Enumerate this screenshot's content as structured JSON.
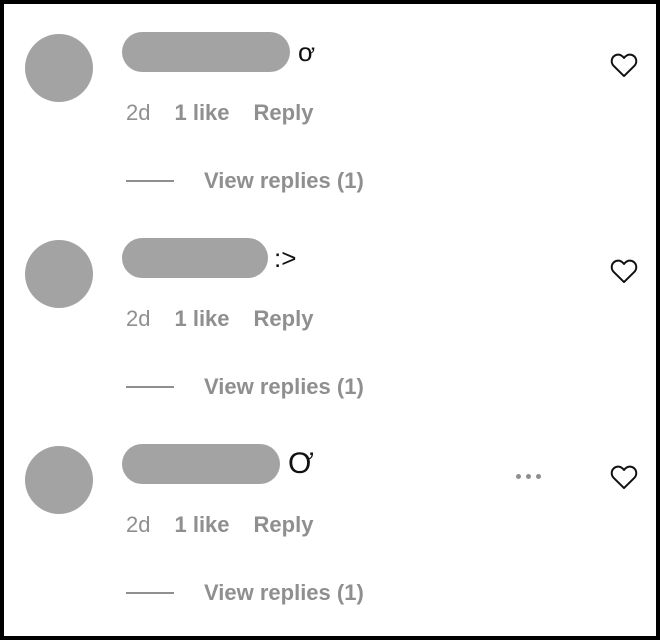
{
  "comments": [
    {
      "text": "ơ",
      "time": "2d",
      "likes": "1 like",
      "reply_label": "Reply",
      "view_replies_label": "View replies (1)",
      "more_options_visible": false
    },
    {
      "text": ":>",
      "time": "2d",
      "likes": "1 like",
      "reply_label": "Reply",
      "view_replies_label": "View replies (1)",
      "more_options_visible": false
    },
    {
      "text": "Ơ",
      "time": "2d",
      "likes": "1 like",
      "reply_label": "Reply",
      "view_replies_label": "View replies (1)",
      "more_options_visible": true
    }
  ],
  "icons": {
    "like": "heart-outline-icon",
    "more": "more-options-icon"
  },
  "colors": {
    "placeholder_gray": "#a3a3a3",
    "secondary_text": "#8f8f8f",
    "primary_text": "#111111",
    "border": "#000000"
  }
}
